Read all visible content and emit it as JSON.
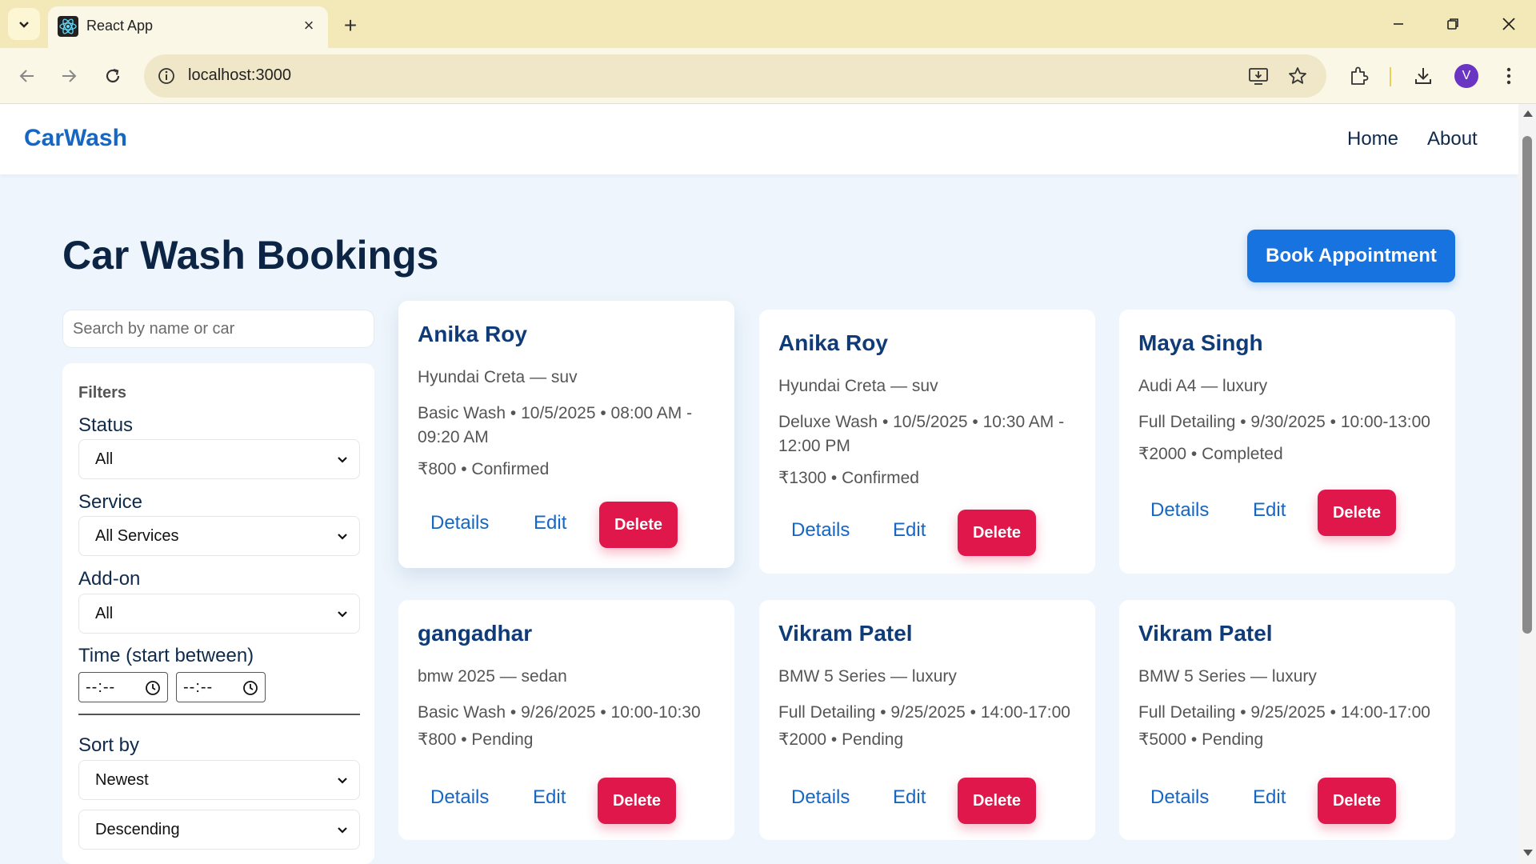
{
  "browser": {
    "tab_title": "React App",
    "url": "localhost:3000",
    "profile_initial": "V"
  },
  "app": {
    "brand": "CarWash",
    "nav": [
      "Home",
      "About"
    ],
    "page_title": "Car Wash Bookings",
    "book_button": "Book Appointment"
  },
  "search": {
    "placeholder": "Search by name or car",
    "value": ""
  },
  "filters": {
    "title": "Filters",
    "status_label": "Status",
    "status_value": "All",
    "service_label": "Service",
    "service_value": "All Services",
    "addon_label": "Add-on",
    "addon_value": "All",
    "time_label": "Time (start between)",
    "time_from": "--:--",
    "time_to": "--:--",
    "sort_label": "Sort by",
    "sort_value": "Newest",
    "order_value": "Descending"
  },
  "card_actions": {
    "details": "Details",
    "edit": "Edit",
    "delete": "Delete"
  },
  "bookings": [
    {
      "name": "Anika Roy",
      "car": "Hyundai Creta — suv",
      "service": "Basic Wash • 10/5/2025 • 08:00 AM - 09:20 AM",
      "price_status": "₹800 • Confirmed"
    },
    {
      "name": "Anika Roy",
      "car": "Hyundai Creta — suv",
      "service": "Deluxe Wash • 10/5/2025 • 10:30 AM - 12:00 PM",
      "price_status": "₹1300 • Confirmed"
    },
    {
      "name": "Maya Singh",
      "car": "Audi A4 — luxury",
      "service": "Full Detailing • 9/30/2025 • 10:00-13:00",
      "price_status": "₹2000 • Completed"
    },
    {
      "name": "gangadhar",
      "car": "bmw 2025 — sedan",
      "service": "Basic Wash • 9/26/2025 • 10:00-10:30",
      "price_status": "₹800 • Pending"
    },
    {
      "name": "Vikram Patel",
      "car": "BMW 5 Series — luxury",
      "service": "Full Detailing • 9/25/2025 • 14:00-17:00",
      "price_status": "₹2000 • Pending"
    },
    {
      "name": "Vikram Patel",
      "car": "BMW 5 Series — luxury",
      "service": "Full Detailing • 9/25/2025 • 14:00-17:00",
      "price_status": "₹5000 • Pending"
    }
  ],
  "colors": {
    "brand_blue": "#1666c4",
    "primary_button": "#1773e0",
    "delete_button": "#e0174a",
    "page_bg": "#eef5fc",
    "tabbar_bg": "#f3e9b8"
  }
}
